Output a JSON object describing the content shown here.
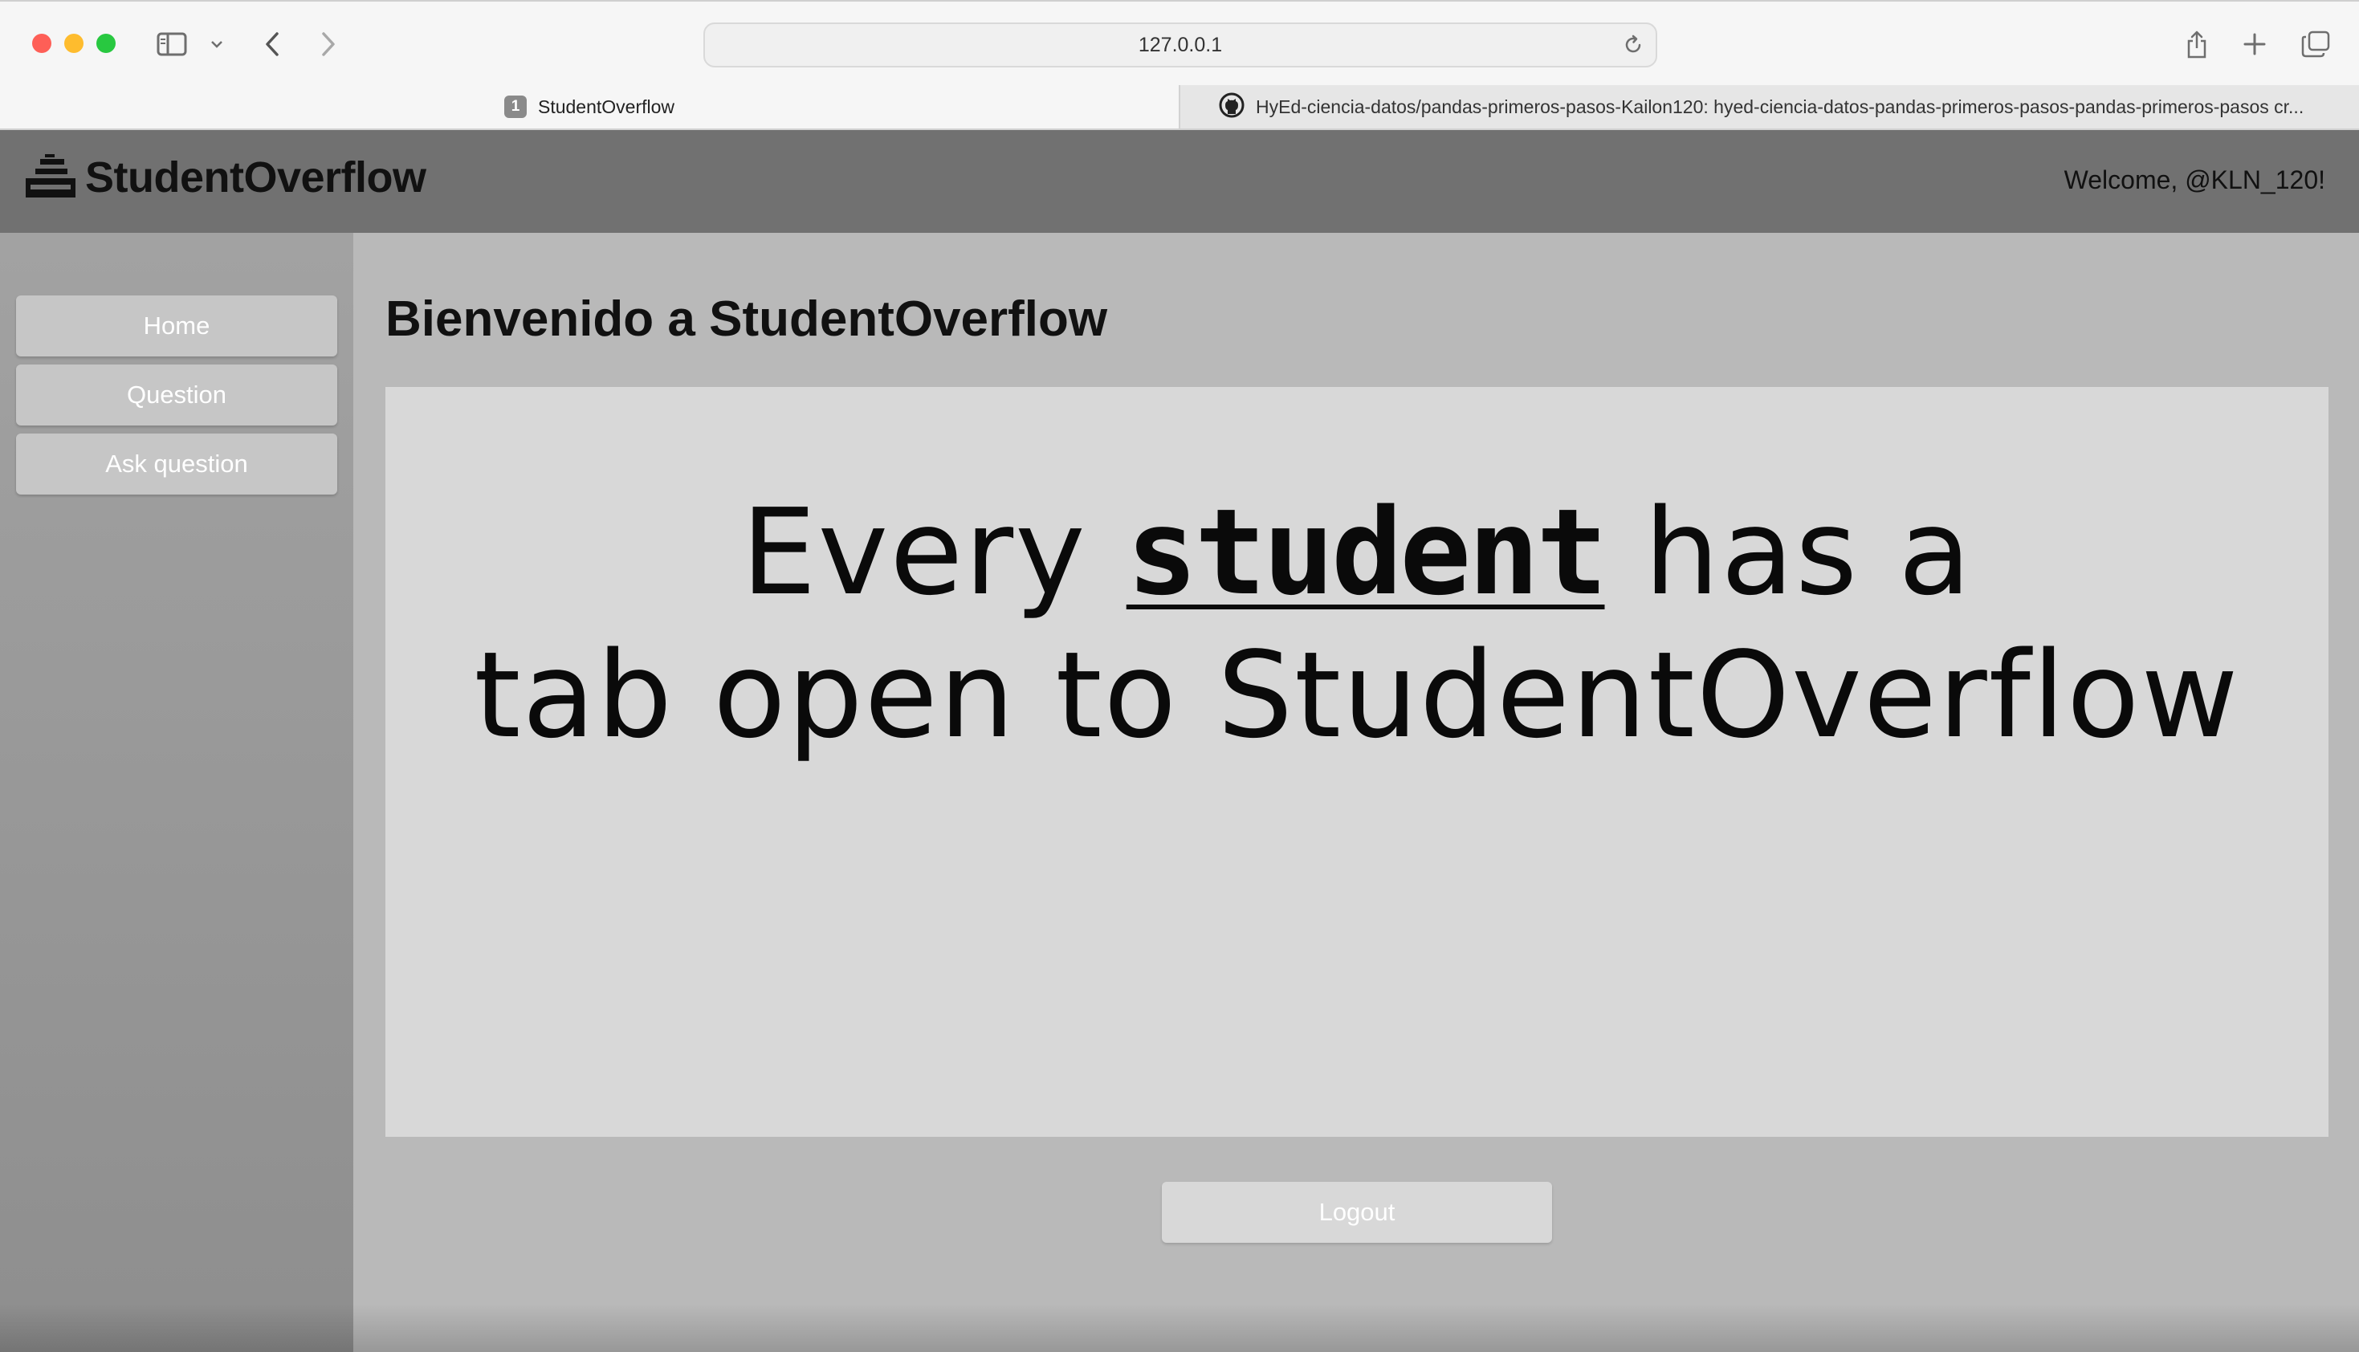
{
  "browser": {
    "url": "127.0.0.1",
    "tabs": [
      {
        "number": "1",
        "title": "StudentOverflow"
      },
      {
        "title": "HyEd-ciencia-datos/pandas-primeros-pasos-Kailon120: hyed-ciencia-datos-pandas-primeros-pasos-pandas-primeros-pasos cr..."
      }
    ]
  },
  "header": {
    "site_name": "StudentOverflow",
    "welcome": "Welcome, @KLN_120!"
  },
  "sidebar": {
    "items": [
      {
        "label": "Home"
      },
      {
        "label": "Question"
      },
      {
        "label": "Ask question"
      }
    ]
  },
  "main": {
    "title": "Bienvenido a StudentOverflow",
    "hero": {
      "line1_before": "Every ",
      "line1_emphasis": "student",
      "line1_after": " has a",
      "line2": "tab open to StudentOverflow"
    },
    "logout_label": "Logout"
  },
  "colors": {
    "header_bg": "#717171",
    "sidebar_bg": "#969696",
    "page_bg": "#b9b9b9",
    "hero_bg": "#d8d8d8",
    "button_bg": "#c6c6c6"
  }
}
